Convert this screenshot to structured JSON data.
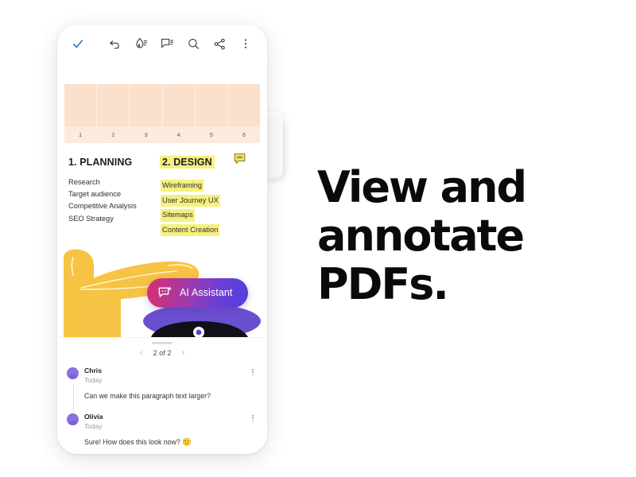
{
  "headline": {
    "line1": "View and",
    "line2": "annotate",
    "line3": "PDFs."
  },
  "colors": {
    "highlight_yellow": "#f6f07e",
    "table_fill": "#fbe0cb",
    "table_footer": "#fdeade",
    "accent_blue": "#2f6fd0",
    "avatar_purple": "#8a70e0",
    "illustration_yellow": "#f6c344",
    "ai_gradient_start": "#d72f6e",
    "ai_gradient_end": "#4e3fe0"
  },
  "toolbar": {
    "check_icon": "check-icon",
    "items": [
      {
        "icon": "undo-icon",
        "label": "Undo"
      },
      {
        "icon": "highlighter-icon",
        "label": "Highlight"
      },
      {
        "icon": "comment-icon",
        "label": "Comment"
      },
      {
        "icon": "search-icon",
        "label": "Search"
      },
      {
        "icon": "share-icon",
        "label": "Share"
      },
      {
        "icon": "more-vertical-icon",
        "label": "More options"
      }
    ]
  },
  "document": {
    "table": {
      "columns": [
        "1",
        "2",
        "3",
        "4",
        "5",
        "6"
      ]
    },
    "sections": [
      {
        "heading": "1. PLANNING",
        "highlighted": false,
        "items": [
          {
            "text": "Research",
            "highlighted": false
          },
          {
            "text": "Target audience",
            "highlighted": false
          },
          {
            "text": "Competitive Analysis",
            "highlighted": false
          },
          {
            "text": "SEO Strategy",
            "highlighted": false
          }
        ]
      },
      {
        "heading": "2. DESIGN",
        "highlighted": true,
        "note_icon": "sticky-note-icon",
        "items": [
          {
            "text": "Wireframing",
            "highlighted": true
          },
          {
            "text": "User Journey UX",
            "highlighted": true
          },
          {
            "text": "Sitemaps",
            "highlighted": true
          },
          {
            "text": "Content Creation",
            "highlighted": true
          }
        ]
      }
    ]
  },
  "ai_button": {
    "label": "AI Assistant",
    "icon": "ai-sparkle-chat-icon"
  },
  "pager": {
    "prev_icon": "chevron-left-icon",
    "next_icon": "chevron-right-icon",
    "label": "2 of 2"
  },
  "comments": [
    {
      "author": "Chris",
      "time": "Today",
      "text": "Can we make this paragraph text larger?",
      "menu_icon": "more-vertical-icon"
    },
    {
      "author": "Olivia",
      "time": "Today",
      "text": "Sure! How does this look now? ",
      "emoji": "🙂",
      "menu_icon": "more-vertical-icon"
    }
  ]
}
